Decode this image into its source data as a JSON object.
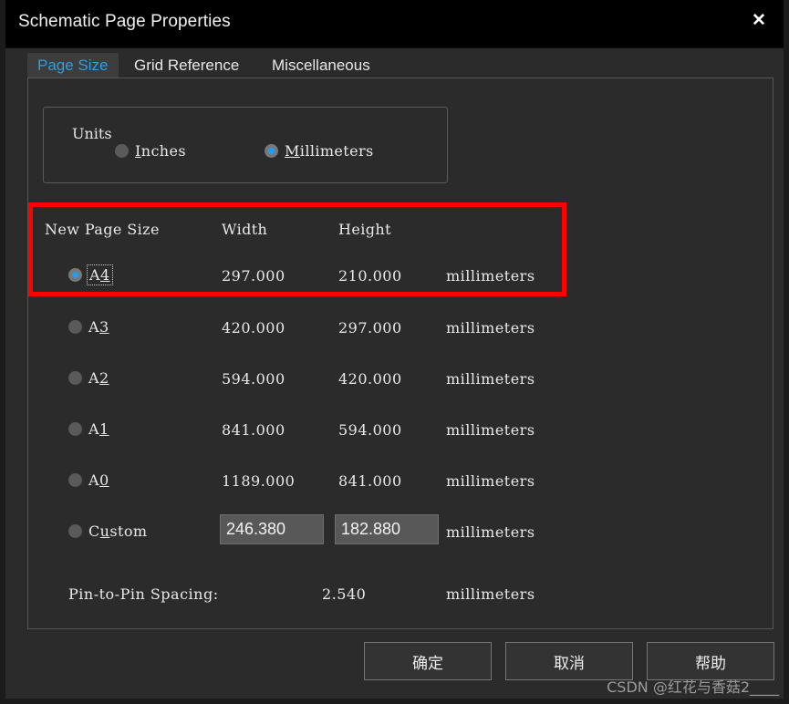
{
  "window": {
    "title": "Schematic Page Properties",
    "close_label": "✕"
  },
  "tabs": [
    {
      "label": "Page Size",
      "active": true
    },
    {
      "label": "Grid Reference",
      "active": false
    },
    {
      "label": "Miscellaneous",
      "active": false
    }
  ],
  "units_group": {
    "legend": "Units",
    "options": [
      {
        "label_pre": "",
        "label_mnemonic": "I",
        "label_post": "nches",
        "selected": false
      },
      {
        "label_pre": "",
        "label_mnemonic": "M",
        "label_post": "illimeters",
        "selected": true
      }
    ]
  },
  "page_size": {
    "header": {
      "name": "New Page Size",
      "width": "Width",
      "height": "Height"
    },
    "rows": [
      {
        "pre": "A",
        "mnemonic": "4",
        "post": "",
        "width": "297.000",
        "height": "210.000",
        "units": "millimeters",
        "selected": true,
        "focused": true,
        "editable": false
      },
      {
        "pre": "A",
        "mnemonic": "3",
        "post": "",
        "width": "420.000",
        "height": "297.000",
        "units": "millimeters",
        "selected": false,
        "focused": false,
        "editable": false
      },
      {
        "pre": "A",
        "mnemonic": "2",
        "post": "",
        "width": "594.000",
        "height": "420.000",
        "units": "millimeters",
        "selected": false,
        "focused": false,
        "editable": false
      },
      {
        "pre": "A",
        "mnemonic": "1",
        "post": "",
        "width": "841.000",
        "height": "594.000",
        "units": "millimeters",
        "selected": false,
        "focused": false,
        "editable": false
      },
      {
        "pre": "A",
        "mnemonic": "0",
        "post": "",
        "width": "1189.000",
        "height": "841.000",
        "units": "millimeters",
        "selected": false,
        "focused": false,
        "editable": false
      },
      {
        "pre": "C",
        "mnemonic": "u",
        "post": "stom",
        "width": "246.380",
        "height": "182.880",
        "units": "millimeters",
        "selected": false,
        "focused": false,
        "editable": true
      }
    ],
    "pin_spacing": {
      "label": "Pin-to-Pin Spacing:",
      "value": "2.540",
      "units": "millimeters"
    }
  },
  "footer": {
    "buttons": [
      {
        "label": "确定"
      },
      {
        "label": "取消"
      },
      {
        "label": "帮助"
      }
    ]
  },
  "annotation": {
    "highlight_color": "#ff0000"
  },
  "watermark": {
    "text": "CSDN @红花与香菇2____"
  }
}
